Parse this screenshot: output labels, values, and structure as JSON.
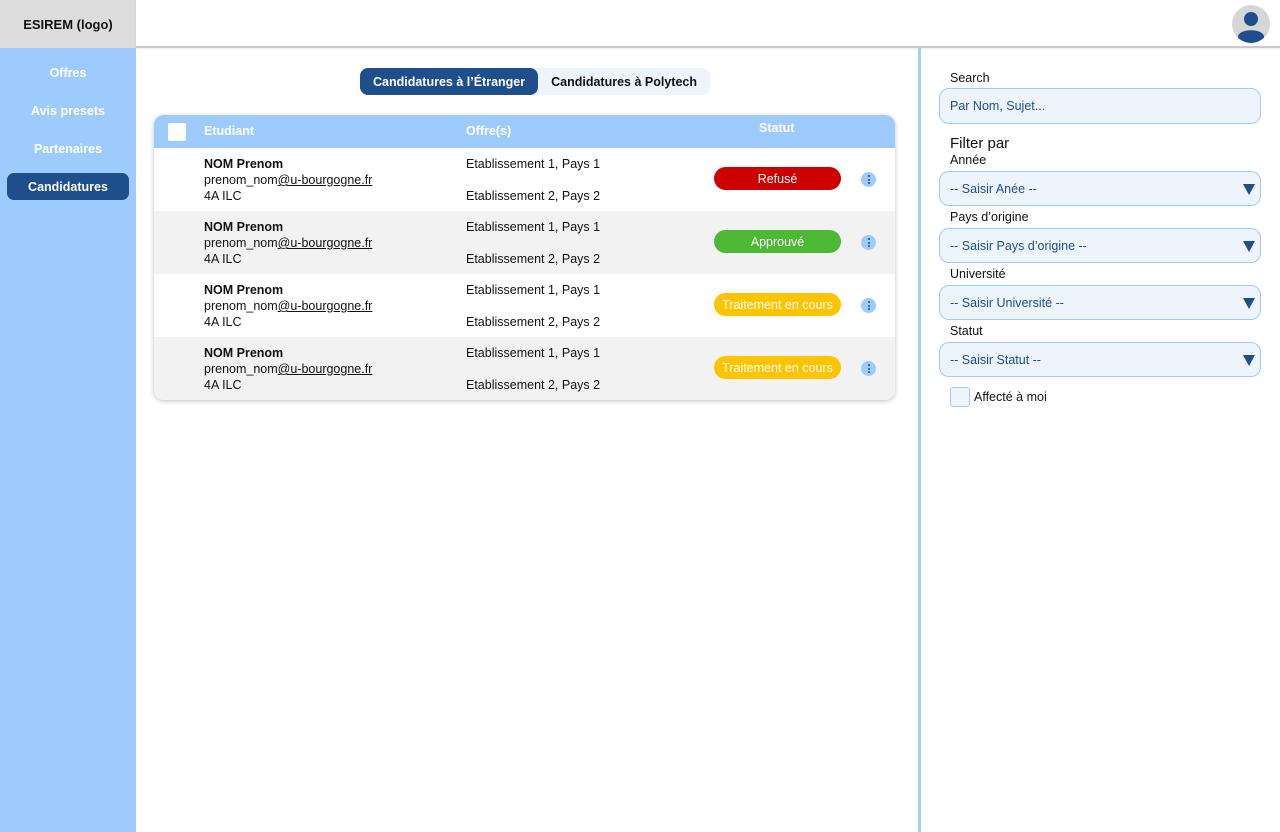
{
  "app": {
    "logo": "ESIREM (logo)"
  },
  "sidebar": {
    "items": [
      {
        "label": "Offres",
        "active": false
      },
      {
        "label": "Avis presets",
        "active": false
      },
      {
        "label": "Partenaires",
        "active": false
      },
      {
        "label": "Candidatures",
        "active": true
      }
    ]
  },
  "tabs": [
    {
      "label": "Candidatures à l’Étranger",
      "active": true
    },
    {
      "label": "Candidatures à Polytech",
      "active": false
    }
  ],
  "table": {
    "headers": {
      "etudiant": "Etudiant",
      "offres": "Offre(s)",
      "statut": "Statut"
    },
    "rows": [
      {
        "name": "NOM Prenom",
        "email_user": "prenom_nom",
        "email_domain": "@u-bourgogne.fr",
        "year": "4A ILC",
        "offer1": "Etablissement 1, Pays 1",
        "offer2": "Etablissement 2, Pays 2",
        "status": "Refusé",
        "status_color": "#cc0000"
      },
      {
        "name": "NOM Prenom",
        "email_user": "prenom_nom",
        "email_domain": "@u-bourgogne.fr",
        "year": "4A ILC",
        "offer1": "Etablissement 1, Pays 1",
        "offer2": "Etablissement 2, Pays 2",
        "status": "Approuvé",
        "status_color": "#4db833"
      },
      {
        "name": "NOM Prenom",
        "email_user": "prenom_nom",
        "email_domain": "@u-bourgogne.fr",
        "year": "4A ILC",
        "offer1": "Etablissement 1, Pays 1",
        "offer2": "Etablissement 2, Pays 2",
        "status": "Traitement en cours",
        "status_color": "#ffc400"
      },
      {
        "name": "NOM Prenom",
        "email_user": "prenom_nom",
        "email_domain": "@u-bourgogne.fr",
        "year": "4A ILC",
        "offer1": "Etablissement 1, Pays 1",
        "offer2": "Etablissement 2, Pays 2",
        "status": "Traitement en cours",
        "status_color": "#ffc400"
      }
    ]
  },
  "filters": {
    "search_label": "Search",
    "search_placeholder": "Par Nom, Sujet...",
    "filter_title": "Filter par",
    "annee_label": "Année",
    "annee_value": "-- Saisir Anée --",
    "pays_label": "Pays d’origine",
    "pays_value": "-- Saisir Pays d’origine --",
    "universite_label": "Université",
    "universite_value": "-- Saisir Université --",
    "statut_label": "Statut",
    "statut_value": "-- Saisir Statut --",
    "assigned_label": "Affecté à moi"
  },
  "colors": {
    "accent": "#1e4f8c",
    "light_blue": "#9ecbfd",
    "refuse": "#cc0000",
    "approuve": "#4db833",
    "en_cours": "#ffc400"
  }
}
